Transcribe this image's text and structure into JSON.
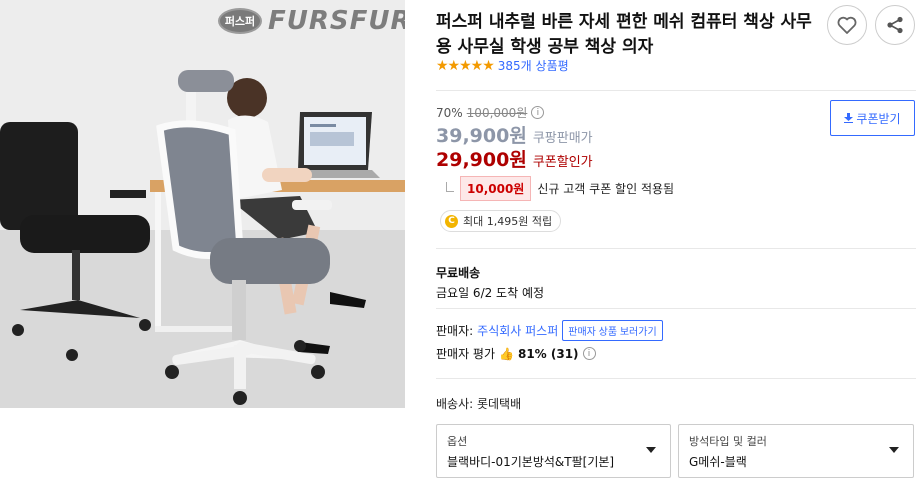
{
  "brand": {
    "seal_text": "퍼스퍼",
    "wordmark": "FURSFUR"
  },
  "product": {
    "title": "퍼스퍼 내추럴 바른 자세 편한 메쉬 컴퓨터 책상 사무용 사무실 학생 공부 책상 의자",
    "rating_stars": "★★★★★",
    "review_count": "385개 상품평"
  },
  "actions": {
    "wishlist_icon": "heart-icon",
    "share_icon": "share-icon"
  },
  "pricing": {
    "discount_rate": "70%",
    "original_price": "100,000원",
    "info_mark": "i",
    "sale_price": "39,900원",
    "sale_label": "쿠팡판매가",
    "coupon_price": "29,900원",
    "coupon_label": "쿠폰할인가",
    "coupon_button": "쿠폰받기",
    "coupon_amount": "10,000원",
    "coupon_text": "신규 고객 쿠폰 할인 적용됨",
    "reward_coin": "C",
    "reward_text": "최대 1,495원 적립"
  },
  "shipping": {
    "label": "무료배송",
    "arrival": "금요일 6/2 도착 예정"
  },
  "seller": {
    "label": "판매자:",
    "name": "주식회사 퍼스퍼",
    "view_button": "판매자 상품 보러가기",
    "rating_label": "판매자 평가",
    "rating_value": "81% (31)"
  },
  "courier": "배송사: 롯데택배",
  "options": [
    {
      "label": "옵션",
      "value": "블랙바디-01기본방석&T팔[기본]"
    },
    {
      "label": "방석타입 및 컬러",
      "value": "G메쉬-블랙"
    }
  ],
  "colors": {
    "accent": "#346aff",
    "coupon_red": "#ae0000",
    "star": "#f39a00"
  }
}
